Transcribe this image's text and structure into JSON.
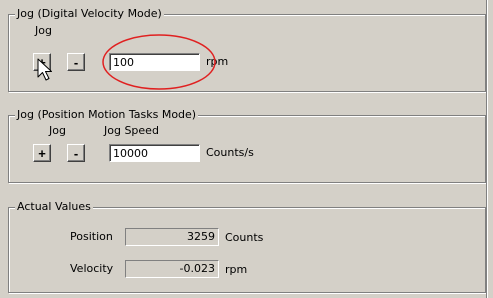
{
  "jog_velocity": {
    "legend": "Jog (Digital Velocity Mode)",
    "jog_label": "Jog",
    "plus_label": "+",
    "minus_label": "-",
    "speed_value": "100",
    "unit": "rpm"
  },
  "jog_position": {
    "legend": "Jog (Position Motion Tasks Mode)",
    "jog_label": "Jog",
    "jog_speed_label": "Jog Speed",
    "plus_label": "+",
    "minus_label": "-",
    "speed_value": "10000",
    "unit": "Counts/s"
  },
  "actual_values": {
    "legend": "Actual Values",
    "position_label": "Position",
    "position_value": "3259",
    "position_unit": "Counts",
    "velocity_label": "Velocity",
    "velocity_value": "-0.023",
    "velocity_unit": "rpm"
  },
  "annotation": {
    "shape": "ellipse",
    "color": "#e02020",
    "target": "jog-velocity-speed-input"
  },
  "cursor": {
    "icon": "arrow-pointer-icon"
  }
}
